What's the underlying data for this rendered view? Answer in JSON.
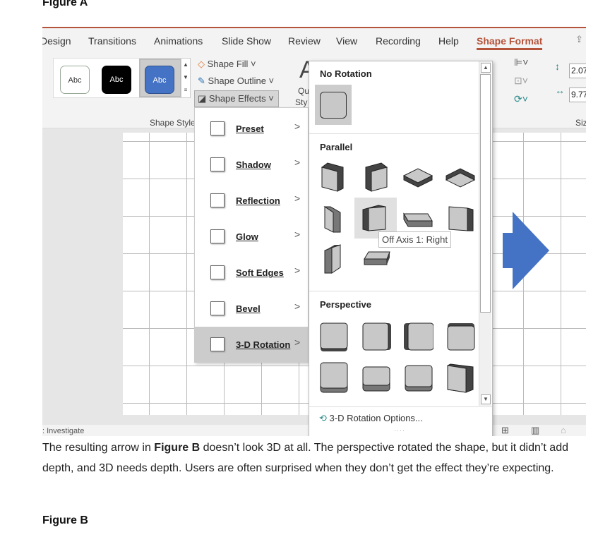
{
  "article": {
    "figure_a": "Figure A",
    "figure_b": "Figure B",
    "paragraph_pre": "The resulting arrow in ",
    "paragraph_bold": "Figure B",
    "paragraph_post": " doesn’t look 3D at all. The perspective rotated the shape, but it didn’t add depth, and 3D needs depth. Users are often surprised when they don’t get the effect they’re expecting."
  },
  "tabs": [
    "Design",
    "Transitions",
    "Animations",
    "Slide Show",
    "Review",
    "View",
    "Recording",
    "Help",
    "Shape Format"
  ],
  "active_tab": "Shape Format",
  "ribbon": {
    "swatch_text": "Abc",
    "shape_fill": "Shape Fill",
    "shape_outline": "Shape Outline",
    "shape_effects": "Shape Effects",
    "group_shape_styles": "Shape Styles",
    "quick_styles_partial_1": "Qu",
    "quick_styles_partial_2": "Sty",
    "size_group_partial": "Siz",
    "height_value": "2.07",
    "width_value": "9.77"
  },
  "effects_menu": [
    {
      "label": "Preset"
    },
    {
      "label": "Shadow"
    },
    {
      "label": "Reflection"
    },
    {
      "label": "Glow"
    },
    {
      "label": "Soft Edges"
    },
    {
      "label": "Bevel"
    },
    {
      "label": "3-D Rotation",
      "highlighted": true
    }
  ],
  "gallery": {
    "no_rotation": "No Rotation",
    "parallel": "Parallel",
    "perspective": "Perspective",
    "parallel_items": [
      "iso-left-down",
      "iso-right-down",
      "iso-top-up",
      "iso-bottom-down",
      "off-axis-1-left",
      "off-axis-1-right",
      "off-axis-1-top",
      "off-axis-2-left",
      "off-axis-2-right",
      "off-axis-2-top"
    ],
    "perspective_items": [
      "perspective-front",
      "perspective-left",
      "perspective-right",
      "perspective-below",
      "perspective-above",
      "perspective-relaxed",
      "perspective-relaxed-moderately",
      "perspective-heroic"
    ],
    "hovered_item": "off-axis-1-right",
    "tooltip": "Off Axis 1: Right",
    "options": "3-D Rotation Options..."
  },
  "status": {
    "left": ": Investigate"
  },
  "colors": {
    "accent": "#b5533a",
    "arrow": "#4472c4",
    "tile_face": "#c8c8c8",
    "tile_side": "#444444"
  }
}
